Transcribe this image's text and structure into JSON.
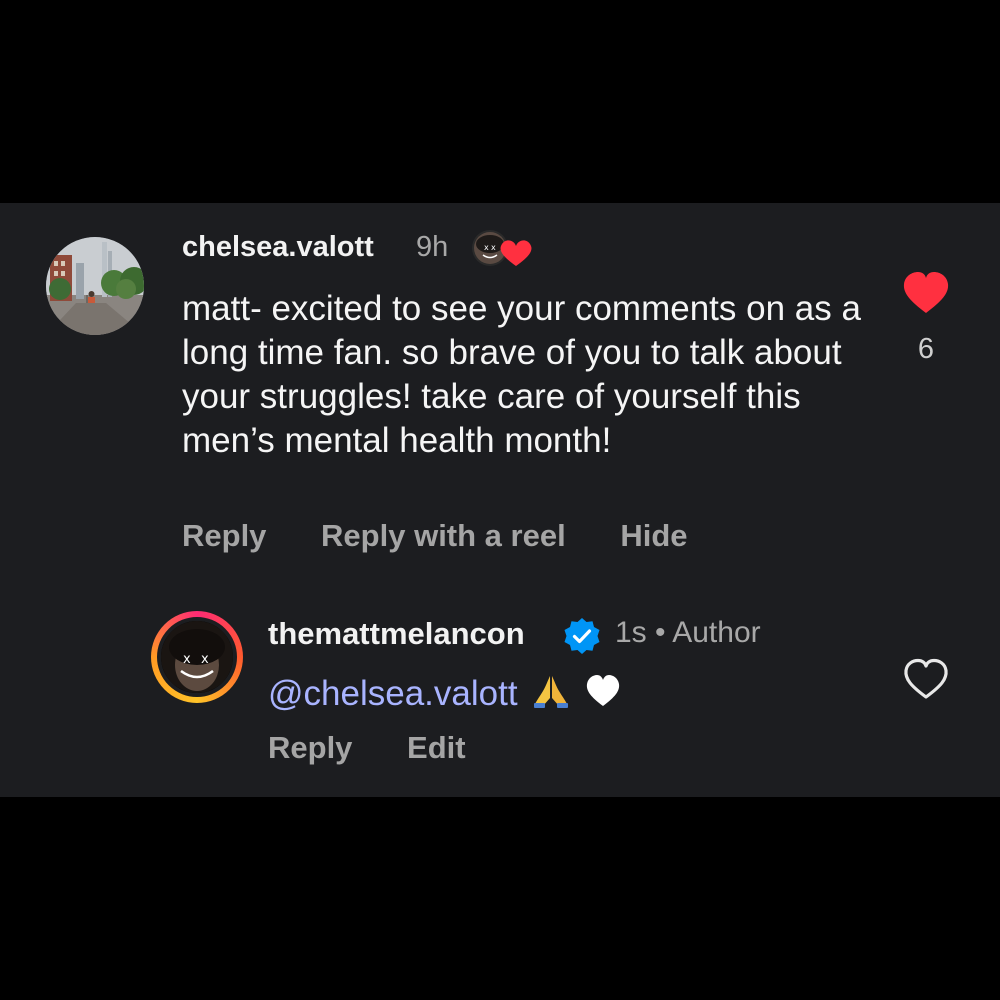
{
  "comment": {
    "username": "chelsea.valott",
    "time": "9h",
    "text": "matt- excited to see your comments on as a long time fan. so brave of you to talk about your struggles! take care of yourself this men’s mental health month!",
    "like_count": "6",
    "liked": true,
    "actions": {
      "reply": "Reply",
      "reply_reel": "Reply with a reel",
      "hide": "Hide"
    },
    "liked_by_author_badge_icon": "author-avatar-heart-icon"
  },
  "reply": {
    "username": "themattmelancon",
    "verified": true,
    "time": "1s",
    "separator": "•",
    "role": "Author",
    "mention": "@chelsea.valott",
    "emojis": [
      "folded-hands-icon",
      "white-heart-icon"
    ],
    "liked": false,
    "actions": {
      "reply": "Reply",
      "edit": "Edit"
    }
  },
  "colors": {
    "panel_bg": "#1c1d20",
    "like_red": "#ff3040",
    "verified_blue": "#0095f6",
    "mention": "#a9b4ff",
    "secondary_text": "#a5a5a5"
  }
}
